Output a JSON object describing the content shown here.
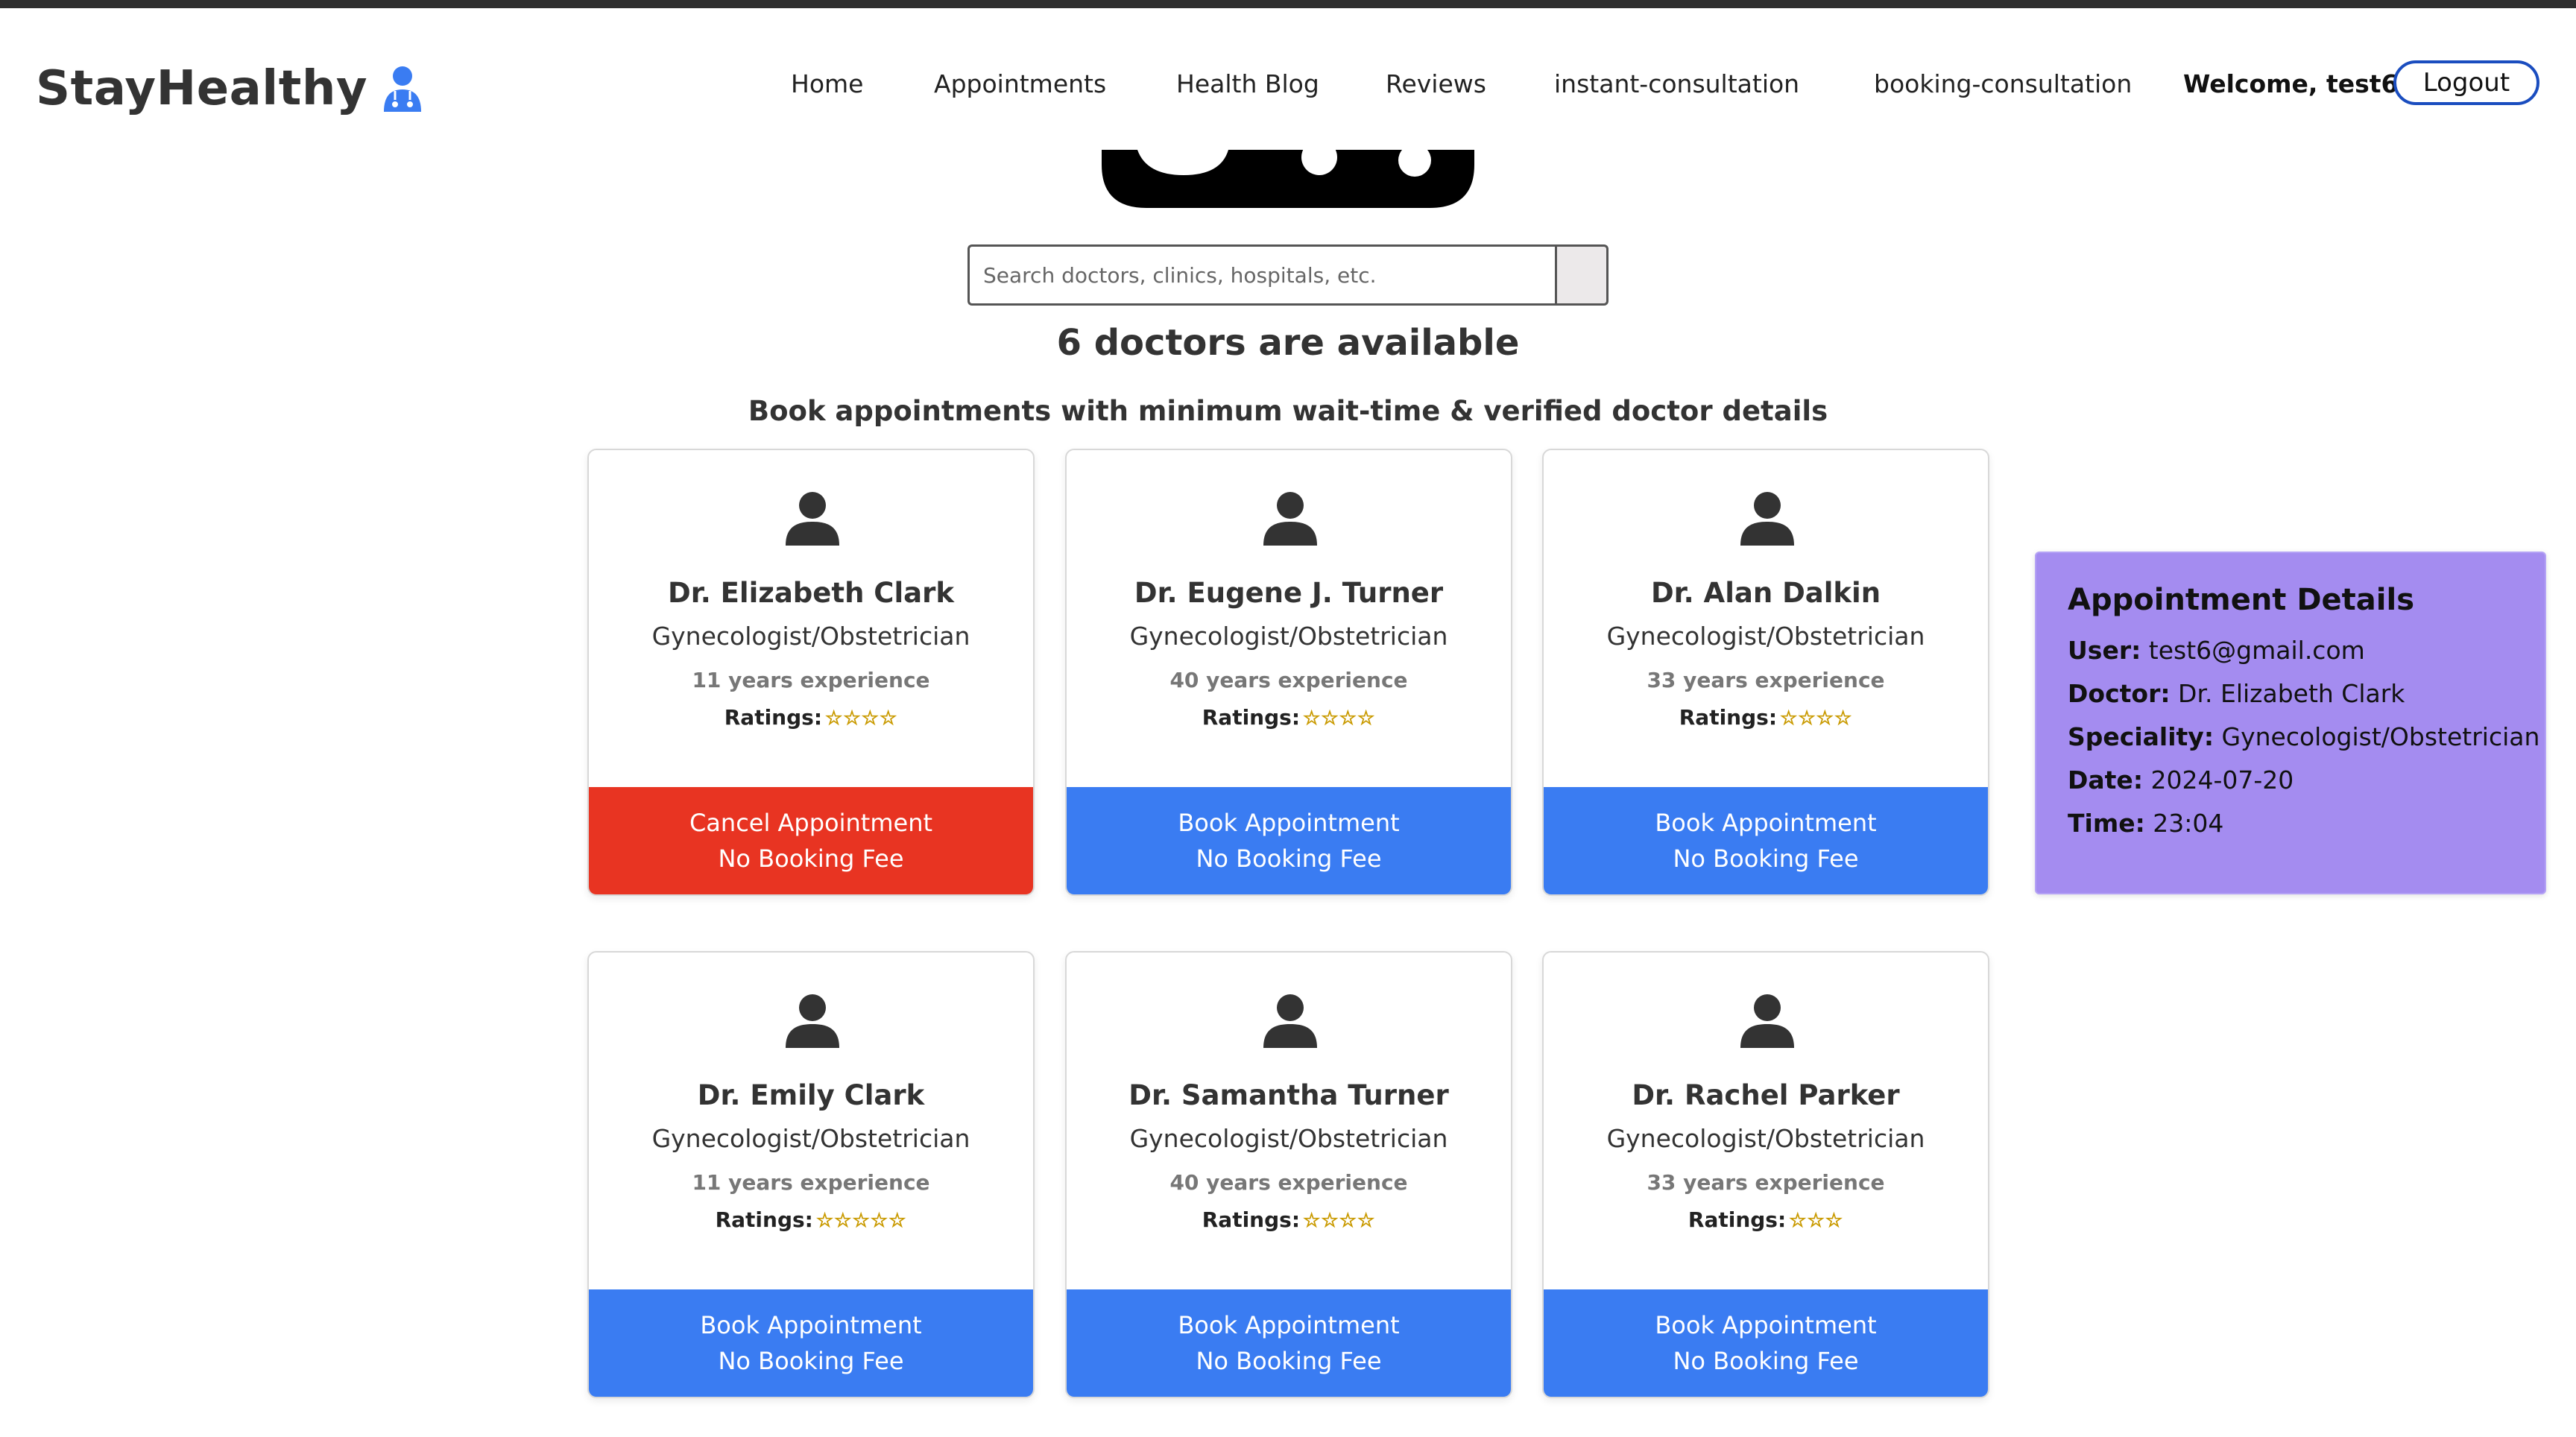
{
  "app": {
    "brand": "StayHealthy"
  },
  "nav": {
    "home": "Home",
    "appointments": "Appointments",
    "health_blog": "Health Blog",
    "reviews": "Reviews",
    "instant": "instant-consultation",
    "booking": "booking-consultation",
    "welcome": "Welcome, test6",
    "logout": "Logout"
  },
  "search": {
    "placeholder": "Search doctors, clinics, hospitals, etc."
  },
  "headline": {
    "count": "6 doctors are available",
    "subtitle": "Book appointments with minimum wait-time & verified doctor details"
  },
  "doctors": [
    {
      "name": "Dr. Elizabeth Clark",
      "speciality": "Gynecologist/Obstetrician",
      "experience": "11 years experience",
      "ratings_label": "Ratings:",
      "stars": "☆☆☆☆",
      "button_line1": "Cancel Appointment",
      "button_line2": "No Booking Fee",
      "state": "booked"
    },
    {
      "name": "Dr. Eugene J. Turner",
      "speciality": "Gynecologist/Obstetrician",
      "experience": "40 years experience",
      "ratings_label": "Ratings:",
      "stars": "☆☆☆☆",
      "button_line1": "Book Appointment",
      "button_line2": "No Booking Fee",
      "state": "available"
    },
    {
      "name": "Dr. Alan Dalkin",
      "speciality": "Gynecologist/Obstetrician",
      "experience": "33 years experience",
      "ratings_label": "Ratings:",
      "stars": "☆☆☆☆",
      "button_line1": "Book Appointment",
      "button_line2": "No Booking Fee",
      "state": "available"
    },
    {
      "name": "Dr. Emily Clark",
      "speciality": "Gynecologist/Obstetrician",
      "experience": "11 years experience",
      "ratings_label": "Ratings:",
      "stars": "☆☆☆☆☆",
      "button_line1": "Book Appointment",
      "button_line2": "No Booking Fee",
      "state": "available"
    },
    {
      "name": "Dr. Samantha Turner",
      "speciality": "Gynecologist/Obstetrician",
      "experience": "40 years experience",
      "ratings_label": "Ratings:",
      "stars": "☆☆☆☆",
      "button_line1": "Book Appointment",
      "button_line2": "No Booking Fee",
      "state": "available"
    },
    {
      "name": "Dr. Rachel Parker",
      "speciality": "Gynecologist/Obstetrician",
      "experience": "33 years experience",
      "ratings_label": "Ratings:",
      "stars": "☆☆☆",
      "button_line1": "Book Appointment",
      "button_line2": "No Booking Fee",
      "state": "available"
    }
  ],
  "appointment": {
    "title": "Appointment Details",
    "user_label": "User:",
    "user": "test6@gmail.com",
    "doctor_label": "Doctor:",
    "doctor": "Dr. Elizabeth Clark",
    "speciality_label": "Speciality:",
    "speciality": "Gynecologist/Obstetrician",
    "date_label": "Date:",
    "date": "2024-07-20",
    "time_label": "Time:",
    "time": "23:04"
  },
  "colors": {
    "book_button": "#3a7cf2",
    "cancel_button": "#e83422",
    "appointment_panel": "#a48cf0",
    "brand_icon": "#3a7cf2"
  },
  "icons": {
    "brand": "doctor-icon",
    "card_avatar": "user-icon"
  }
}
